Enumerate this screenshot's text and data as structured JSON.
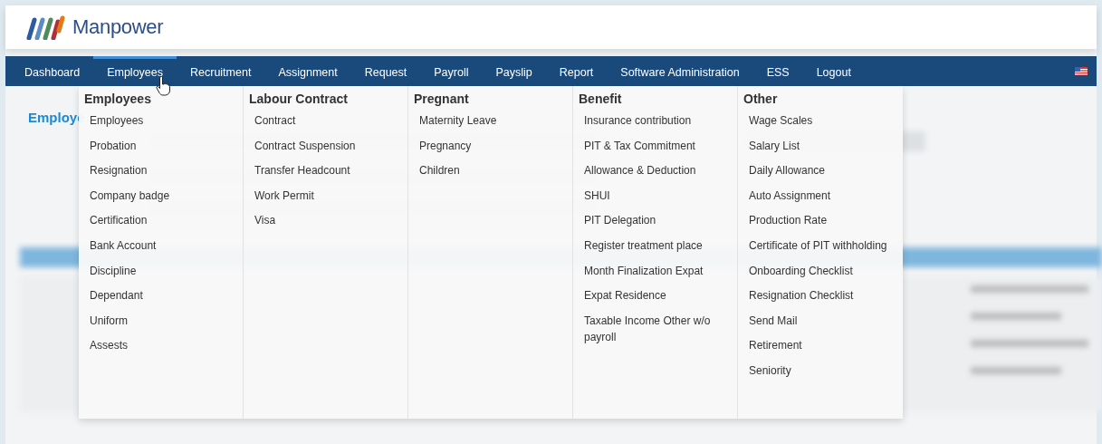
{
  "header": {
    "logo_text": "Manpower"
  },
  "nav": {
    "items": [
      {
        "label": "Dashboard",
        "selected": false
      },
      {
        "label": "Employees",
        "selected": true
      },
      {
        "label": "Recruitment",
        "selected": false
      },
      {
        "label": "Assignment",
        "selected": false
      },
      {
        "label": "Request",
        "selected": false
      },
      {
        "label": "Payroll",
        "selected": false
      },
      {
        "label": "Payslip",
        "selected": false
      },
      {
        "label": "Report",
        "selected": false
      },
      {
        "label": "Software Administration",
        "selected": false
      },
      {
        "label": "ESS",
        "selected": false
      },
      {
        "label": "Logout",
        "selected": false
      }
    ]
  },
  "page": {
    "title": "Employe"
  },
  "mega_menu": {
    "columns": [
      {
        "heading": "Employees",
        "items": [
          "Employees",
          "Probation",
          "Resignation",
          "Company badge",
          "Certification",
          "Bank Account",
          "Discipline",
          "Dependant",
          "Uniform",
          "Assests"
        ]
      },
      {
        "heading": "Labour Contract",
        "items": [
          "Contract",
          "Contract Suspension",
          "Transfer Headcount",
          "Work Permit",
          "Visa"
        ]
      },
      {
        "heading": "Pregnant",
        "items": [
          "Maternity Leave",
          "Pregnancy",
          "Children"
        ]
      },
      {
        "heading": "Benefit",
        "items": [
          "Insurance contribution",
          "PIT & Tax Commitment",
          "Allowance & Deduction",
          "SHUI",
          "PIT Delegation",
          "Register treatment place",
          "Month Finalization Expat",
          "Expat Residence",
          "Taxable Income Other w/o payroll"
        ]
      },
      {
        "heading": "Other",
        "items": [
          "Wage Scales",
          "Salary List",
          "Daily Allowance",
          "Auto Assignment",
          "Production Rate",
          "Certificate of PIT withholding",
          "Onboarding Checklist",
          "Resignation Checklist",
          "Send Mail",
          "Retirement",
          "Seniority"
        ]
      }
    ]
  }
}
